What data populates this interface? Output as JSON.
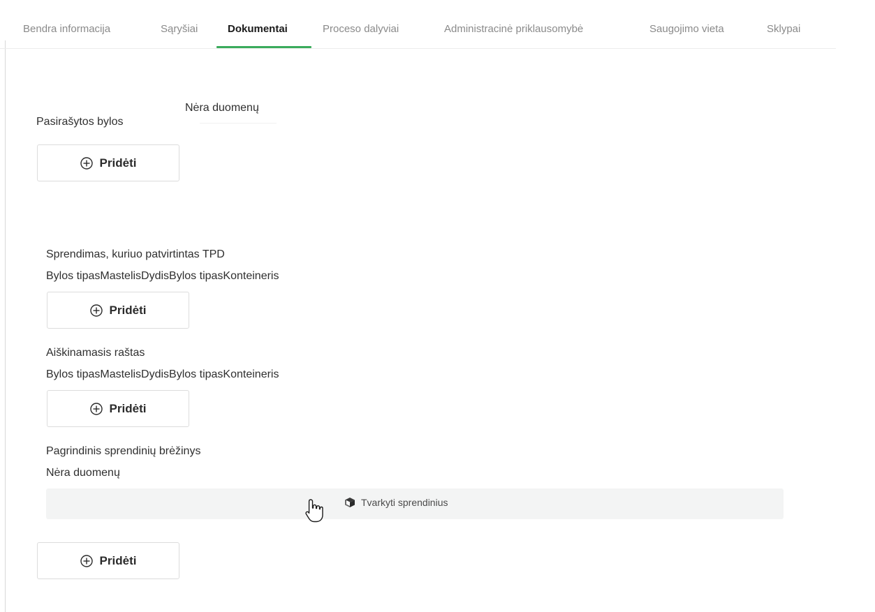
{
  "tabs": [
    {
      "label": "Bendra informacija",
      "active": false
    },
    {
      "label": "Sąryšiai",
      "active": false
    },
    {
      "label": "Dokumentai",
      "active": true
    },
    {
      "label": "Proceso dalyviai",
      "active": false
    },
    {
      "label": "Administracinė priklausomybė",
      "active": false
    },
    {
      "label": "Saugojimo vieta",
      "active": false
    },
    {
      "label": "Sklypai",
      "active": false
    }
  ],
  "accent_color": "#3bab5c",
  "signed_files": {
    "label": "Pasirašytos bylos",
    "empty_text": "Nėra duomenų",
    "add_label": "Pridėti"
  },
  "sections": [
    {
      "title": "Sprendimas, kuriuo patvirtintas TPD",
      "columns_text": "Bylos tipasMastelisDydisBylos tipasKonteineris",
      "add_label": "Pridėti"
    },
    {
      "title": "Aiškinamasis raštas",
      "columns_text": "Bylos tipasMastelisDydisBylos tipasKonteineris",
      "add_label": "Pridėti"
    },
    {
      "title": "Pagrindinis sprendinių brėžinys",
      "empty_text": "Nėra duomenų",
      "manage_label": "Tvarkyti sprendinius",
      "add_label": "Pridėti"
    }
  ],
  "icons": {
    "add": "plus-circle-icon",
    "manage": "cube-icon",
    "cursor": "hand-pointer-cursor-icon"
  }
}
